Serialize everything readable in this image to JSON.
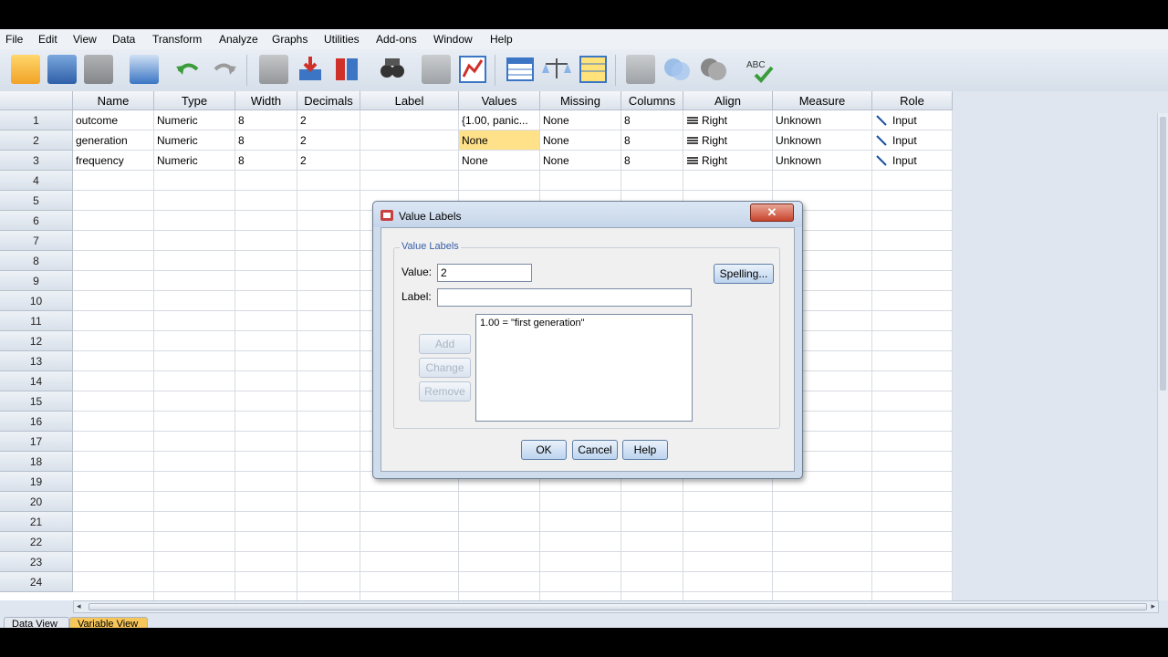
{
  "menu": [
    "File",
    "Edit",
    "View",
    "Data",
    "Transform",
    "Analyze",
    "Graphs",
    "Utilities",
    "Add-ons",
    "Window",
    "Help"
  ],
  "toolbar": {
    "icons": [
      "open-icon",
      "save-icon",
      "print-icon",
      "recall-dialog-icon",
      "undo-icon",
      "redo-icon",
      "goto-case-icon",
      "goto-variable-icon",
      "variables-icon",
      "find-icon",
      "insert-cases-icon",
      "insert-variable-icon",
      "split-file-icon",
      "weight-cases-icon",
      "select-cases-icon",
      "value-labels-icon",
      "use-variable-sets-icon",
      "show-all-variables-icon",
      "spell-check-icon"
    ]
  },
  "columns": [
    "Name",
    "Type",
    "Width",
    "Decimals",
    "Label",
    "Values",
    "Missing",
    "Columns",
    "Align",
    "Measure",
    "Role"
  ],
  "rows": [
    {
      "num": "1",
      "name": "outcome",
      "type": "Numeric",
      "width": "8",
      "decimals": "2",
      "label": "",
      "values": "{1.00, panic...",
      "missing": "None",
      "columns": "8",
      "align": "Right",
      "measure": "Unknown",
      "role": "Input"
    },
    {
      "num": "2",
      "name": "generation",
      "type": "Numeric",
      "width": "8",
      "decimals": "2",
      "label": "",
      "values": "None",
      "missing": "None",
      "columns": "8",
      "align": "Right",
      "measure": "Unknown",
      "role": "Input"
    },
    {
      "num": "3",
      "name": "frequency",
      "type": "Numeric",
      "width": "8",
      "decimals": "2",
      "label": "",
      "values": "None",
      "missing": "None",
      "columns": "8",
      "align": "Right",
      "measure": "Unknown",
      "role": "Input"
    }
  ],
  "row_numbers": [
    "1",
    "2",
    "3",
    "4",
    "5",
    "6",
    "7",
    "8",
    "9",
    "10",
    "11",
    "12",
    "13",
    "14",
    "15",
    "16",
    "17",
    "18",
    "19",
    "20",
    "21",
    "22",
    "23",
    "24"
  ],
  "tabs": [
    "Data View",
    "Variable View"
  ],
  "dialog": {
    "title": "Value Labels",
    "group_label": "Value Labels",
    "value_label": "Value:",
    "value": "2",
    "label_label": "Label:",
    "label_value": "",
    "list_items": [
      "1.00 = \"first generation\""
    ],
    "spelling": "Spelling...",
    "add": "Add",
    "change": "Change",
    "remove": "Remove",
    "ok": "OK",
    "cancel": "Cancel",
    "help": "Help"
  }
}
